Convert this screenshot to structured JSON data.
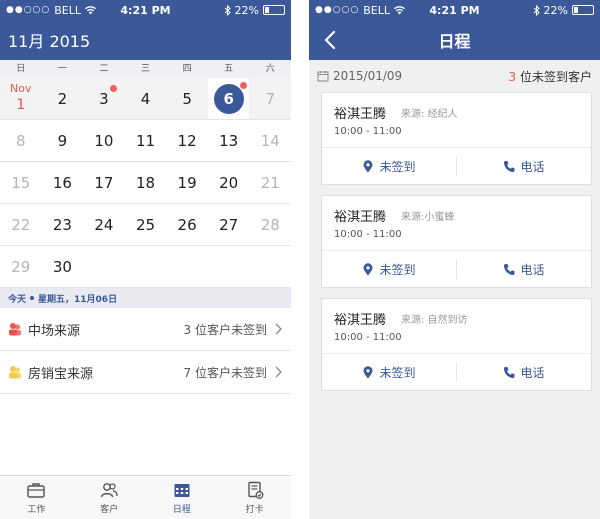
{
  "status": {
    "carrier": "BELL",
    "time": "4:21 PM",
    "battery": "22%",
    "battery_level": 0.22
  },
  "left": {
    "month_title": "11月 2015",
    "weekdays": [
      "日",
      "一",
      "二",
      "三",
      "四",
      "五",
      "六"
    ],
    "weeks": [
      [
        {
          "n": "1",
          "nov": "Nov",
          "muted": false,
          "firstnov": true
        },
        {
          "n": "2"
        },
        {
          "n": "3",
          "dot": true
        },
        {
          "n": "4"
        },
        {
          "n": "5"
        },
        {
          "n": "6",
          "selected": true,
          "dot": true
        },
        {
          "n": "7",
          "muted": true
        }
      ],
      [
        {
          "n": "8",
          "muted": true
        },
        {
          "n": "9"
        },
        {
          "n": "10"
        },
        {
          "n": "11"
        },
        {
          "n": "12"
        },
        {
          "n": "13"
        },
        {
          "n": "14",
          "muted": true
        }
      ],
      [
        {
          "n": "15",
          "muted": true
        },
        {
          "n": "16"
        },
        {
          "n": "17"
        },
        {
          "n": "18"
        },
        {
          "n": "19"
        },
        {
          "n": "20"
        },
        {
          "n": "21",
          "muted": true
        }
      ],
      [
        {
          "n": "22",
          "muted": true
        },
        {
          "n": "23"
        },
        {
          "n": "24"
        },
        {
          "n": "25"
        },
        {
          "n": "26"
        },
        {
          "n": "27"
        },
        {
          "n": "28",
          "muted": true
        }
      ],
      [
        {
          "n": "29",
          "muted": true
        },
        {
          "n": "30"
        }
      ]
    ],
    "today_label": "今天",
    "today_date": "星期五，11月06日",
    "sources": [
      {
        "label": "中场来源",
        "value": "3 位客户未签到",
        "icon_color": "#e8564c"
      },
      {
        "label": "房销宝来源",
        "value": "7 位客户未签到",
        "icon_color": "#f2c94c"
      }
    ],
    "tabs": [
      {
        "label": "工作",
        "icon": "briefcase-icon",
        "active": false
      },
      {
        "label": "客户",
        "icon": "users-icon",
        "active": false
      },
      {
        "label": "日程",
        "icon": "calendar-icon",
        "active": true
      },
      {
        "label": "打卡",
        "icon": "checkin-icon",
        "active": false
      }
    ]
  },
  "right": {
    "title": "日程",
    "date": "2015/01/09",
    "count": "3",
    "count_suffix": " 位未签到客户",
    "cards": [
      {
        "name": "裕淇王腾",
        "source": "来源: 经纪人",
        "time": "10:00 - 11:00",
        "checkin": "未签到",
        "call": "电话"
      },
      {
        "name": "裕淇王腾",
        "source": "来源:小蜜蜂",
        "time": "10:00 - 11:00",
        "checkin": "未签到",
        "call": "电话"
      },
      {
        "name": "裕淇王腾",
        "source": "来源: 自然到访",
        "time": "10:00 - 11:00",
        "checkin": "未签到",
        "call": "电话"
      }
    ]
  },
  "colors": {
    "brand": "#3b5998",
    "accent_red": "#e05a4e"
  }
}
